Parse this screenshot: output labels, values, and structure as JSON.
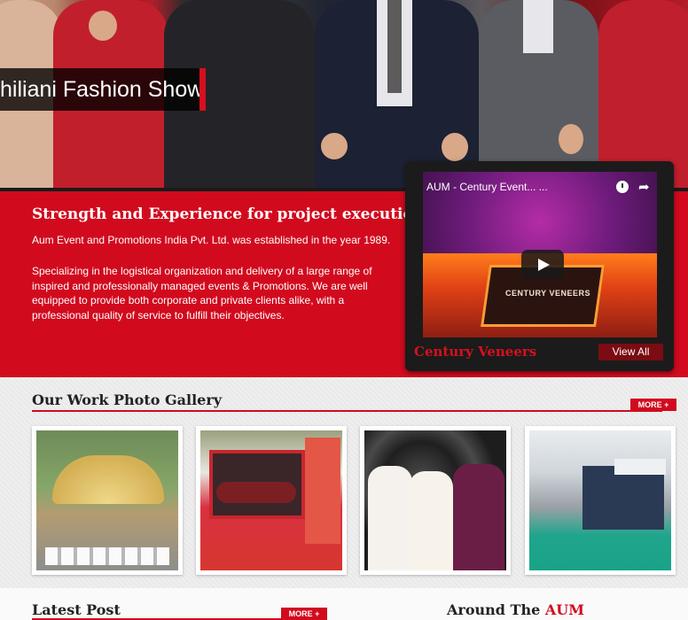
{
  "hero": {
    "caption": "hiliani Fashion Show"
  },
  "intro": {
    "title": "Strength and Experience for project execution",
    "para1": "Aum Event and Promotions India Pvt. Ltd. was established in the year 1989.",
    "para2": "Specializing in the logistical organization and delivery of a large range of inspired and professionally managed events & Promotions. We are well equipped to provide both corporate and private clients alike, with a professional quality of service to fulfill their objectives."
  },
  "video": {
    "title": "AUM - Century Event... ...",
    "stage_text": "CENTURY VENEERS",
    "caption": "Century Veneers",
    "view_all_label": "View All",
    "icons": [
      "clock-icon",
      "share-icon",
      "play-icon"
    ]
  },
  "gallery": {
    "heading": "Our Work Photo Gallery",
    "more_label": "MORE +"
  },
  "latest": {
    "heading": "Latest Post",
    "more_label": "MORE +"
  },
  "around": {
    "heading_prefix": "Around The ",
    "heading_accent": "AUM"
  },
  "colors": {
    "brand_red": "#d20a1e",
    "dark_red": "#7a0c12"
  }
}
